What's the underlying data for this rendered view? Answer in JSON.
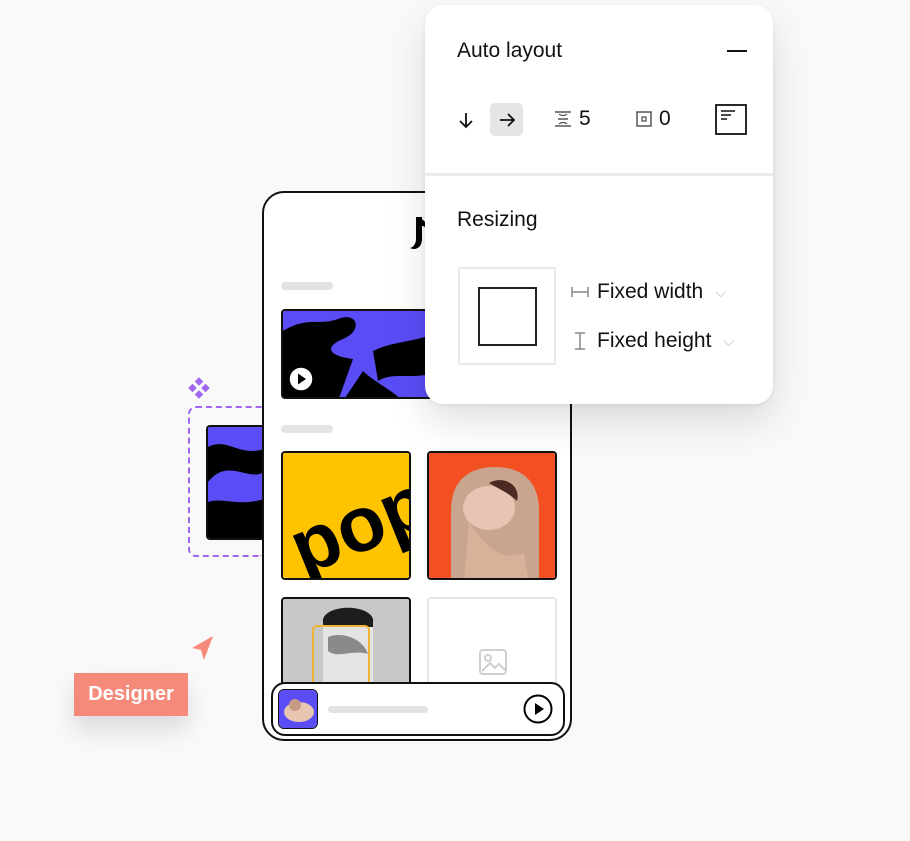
{
  "auto_layout": {
    "title": "Auto layout",
    "collapse_icon": "minus-icon",
    "direction_vertical_icon": "arrow-down-icon",
    "direction_horizontal_icon": "arrow-right-icon",
    "spacing_value": "5",
    "padding_value": "0",
    "alignment_icon": "align-top-left-icon"
  },
  "resizing": {
    "title": "Resizing",
    "width_label": "Fixed width",
    "height_label": "Fixed height"
  },
  "cursor_label": "Designer",
  "colors": {
    "accent_purple": "#a066f0",
    "tag_salmon": "#f58a7b",
    "art_blue": "#5b4df6",
    "art_yellow": "#ffc300",
    "art_orange": "#f25022"
  },
  "phone": {
    "play_icon": "play-icon",
    "image_placeholder_icon": "image-icon"
  }
}
